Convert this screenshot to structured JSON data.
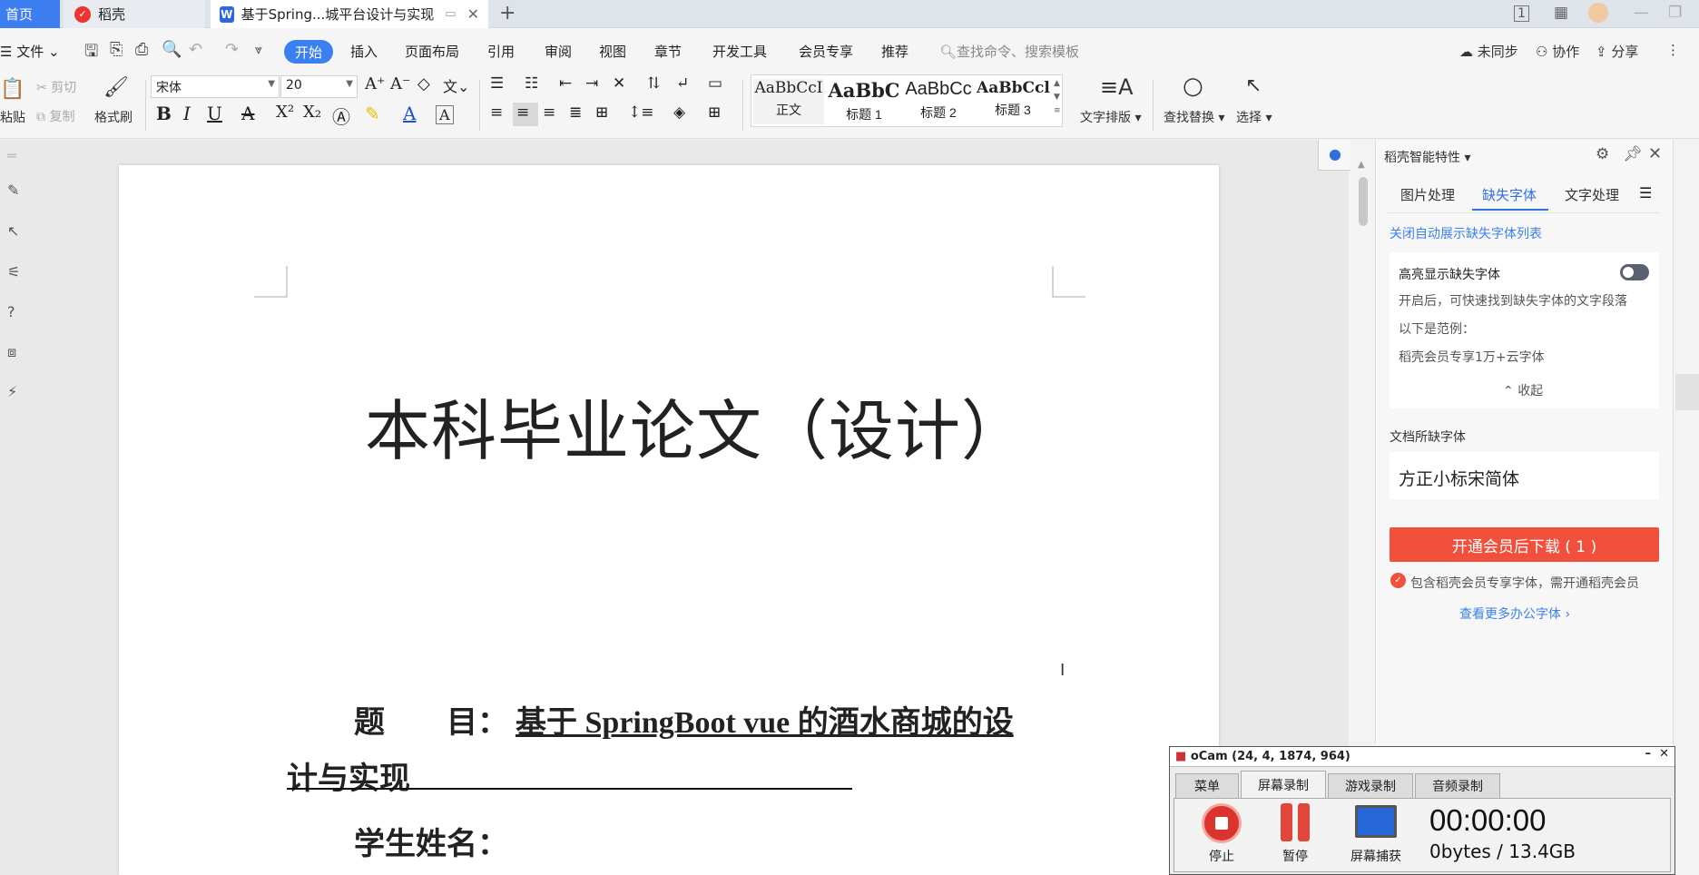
{
  "tabs": {
    "home": "首页",
    "daoke": "稻壳",
    "doc": "基于Spring...城平台设计与实现"
  },
  "menu": {
    "file": "文件",
    "items": [
      "开始",
      "插入",
      "页面布局",
      "引用",
      "审阅",
      "视图",
      "章节",
      "开发工具",
      "会员专享",
      "推荐"
    ],
    "search_placeholder": "查找命令、搜索模板",
    "sync": "未同步",
    "collab": "协作",
    "share": "分享"
  },
  "ribbon": {
    "paste": "粘贴",
    "cut": "剪切",
    "copy": "复制",
    "format_painter": "格式刷",
    "font_name": "宋体",
    "font_size": "20",
    "styles": [
      {
        "sample": "AaBbCcI",
        "name": "正文"
      },
      {
        "sample": "AaBbC",
        "name": "标题 1"
      },
      {
        "sample": "AaBbCc",
        "name": "标题 2"
      },
      {
        "sample": "AaBbCcl",
        "name": "标题 3"
      }
    ],
    "text_layout": "文字排版",
    "find_replace": "查找替换",
    "select": "选择"
  },
  "document": {
    "title": "本科毕业论文（设计）",
    "topic_label": "题　　目：",
    "topic_value_1": "基于 SpringBoot vue 的酒水商城的设",
    "topic_value_2": "计与实现",
    "student_label": "学生姓名："
  },
  "panel": {
    "header": "稻壳智能特性",
    "tabs": [
      "图片处理",
      "缺失字体",
      "文字处理"
    ],
    "active_tab": "缺失字体",
    "close_auto_link": "关闭自动展示缺失字体列表",
    "highlight_title": "高亮显示缺失字体",
    "highlight_desc": "开启后，可快速找到缺失字体的文字段落",
    "example_label": "以下是范例：",
    "example_text": "稻壳会员专享1万+云字体",
    "collapse": "收起",
    "missing_label": "文档所缺字体",
    "missing_font": "方正小标宋简体",
    "download_btn": "开通会员后下载 ( 1 )",
    "note": "包含稻壳会员专享字体，需开通稻壳会员",
    "more_link": "查看更多办公字体"
  },
  "ocam": {
    "title": "oCam (24, 4, 1874, 964)",
    "tabs": [
      "菜单",
      "屏幕录制",
      "游戏录制",
      "音频录制"
    ],
    "active_tab": "屏幕录制",
    "stop": "停止",
    "pause": "暂停",
    "capture": "屏幕捕获",
    "time": "00:00:00",
    "size": "0bytes / 13.4GB"
  },
  "colors": {
    "accent": "#3b80f0",
    "download": "#f1503c",
    "link": "#3b80f0"
  }
}
